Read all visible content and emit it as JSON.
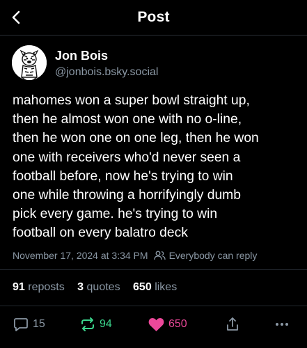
{
  "header": {
    "title": "Post",
    "back_icon": "chevron-left-icon"
  },
  "author": {
    "name": "Jon Bois",
    "handle": "@jonbois.bsky.social",
    "avatar_icon": "cartoon-avatar"
  },
  "post": {
    "lines": [
      "mahomes won a super bowl straight up,",
      "then he almost won one with no o-line,",
      "then he won one on one leg, then he won",
      "one with receivers who'd never seen a",
      "football before, now he's trying to win",
      "one while throwing a horrifyingly dumb",
      "pick every game. he's trying to win",
      "football on every balatro deck"
    ],
    "timestamp": "November 17, 2024 at 3:34 PM",
    "reply_setting": "Everybody can reply"
  },
  "stats": {
    "reposts_count": "91",
    "reposts_label": "reposts",
    "quotes_count": "3",
    "quotes_label": "quotes",
    "likes_count": "650",
    "likes_label": "likes"
  },
  "actions": {
    "reply_count": "15",
    "repost_count": "94",
    "like_count": "650"
  },
  "colors": {
    "background": "#000000",
    "muted_text": "#8b98a5",
    "repost_green": "#3bd48c",
    "like_pink": "#ec4899",
    "divider": "#22272e"
  }
}
